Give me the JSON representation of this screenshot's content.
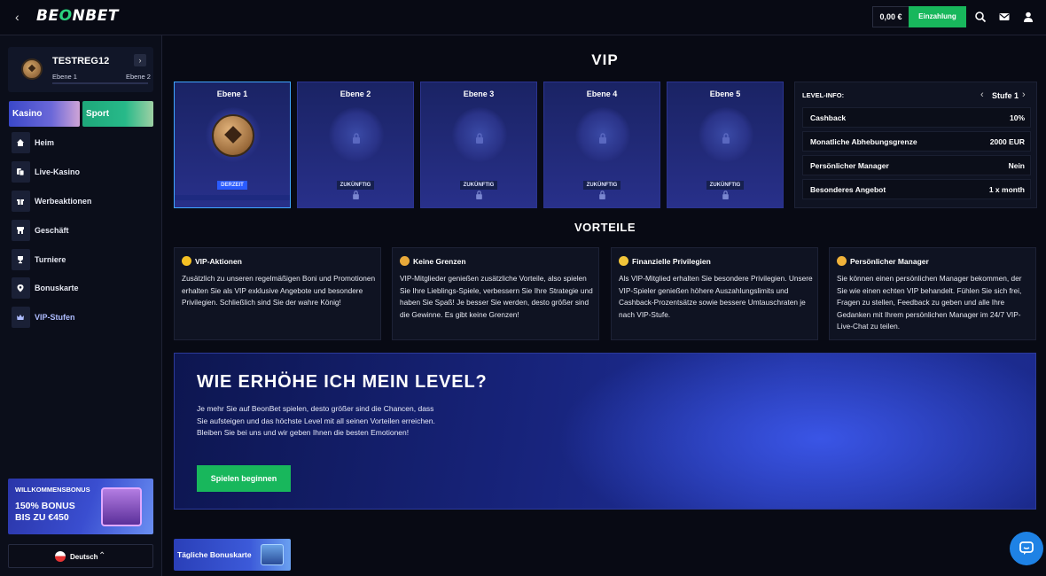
{
  "header": {
    "logo": "BEONBET",
    "balance": "0,00 €",
    "deposit_label": "Einzahlung"
  },
  "profile": {
    "username": "TESTREG12",
    "current_level": "Ebene 1",
    "next_level": "Ebene 2"
  },
  "categories": {
    "casino": "Kasino",
    "sport": "Sport"
  },
  "nav": {
    "items": [
      "Heim",
      "Live-Kasino",
      "Werbeaktionen",
      "Geschäft",
      "Turniere",
      "Bonuskarte",
      "VIP-Stufen"
    ]
  },
  "promo": {
    "small": "WILLKOMMENSBONUS",
    "big": "150% BONUS BIS ZU €450"
  },
  "language": {
    "label": "Deutsch"
  },
  "vip": {
    "title": "VIP",
    "tiers": [
      {
        "name": "Ebene 1",
        "status": "DERZEIT"
      },
      {
        "name": "Ebene 2",
        "status": "ZUKÜNFTIG"
      },
      {
        "name": "Ebene 3",
        "status": "ZUKÜNFTIG"
      },
      {
        "name": "Ebene 4",
        "status": "ZUKÜNFTIG"
      },
      {
        "name": "Ebene 5",
        "status": "ZUKÜNFTIG"
      }
    ]
  },
  "level_info": {
    "heading": "LEVEL-INFO:",
    "stage": "Stufe 1",
    "rows": [
      {
        "key": "Cashback",
        "value": "10%"
      },
      {
        "key": "Monatliche Abhebungsgrenze",
        "value": "2000 EUR"
      },
      {
        "key": "Persönlicher Manager",
        "value": "Nein"
      },
      {
        "key": "Besonderes Angebot",
        "value": "1 x month"
      }
    ]
  },
  "benefits": {
    "title": "VORTEILE",
    "cards": [
      {
        "title": "VIP-Aktionen",
        "text": "Zusätzlich zu unseren regelmäßigen Boni und Promotionen erhalten Sie als VIP exklusive Angebote und besondere Privilegien. Schließlich sind Sie der wahre König!",
        "icon": "lightning-icon"
      },
      {
        "title": "Keine Grenzen",
        "text": "VIP-Mitglieder genießen zusätzliche Vorteile, also spielen Sie Ihre Lieblings-Spiele, verbessern Sie Ihre Strategie und haben Sie Spaß! Je besser Sie werden, desto größer sind die Gewinne. Es gibt keine Grenzen!",
        "icon": "coin-icon"
      },
      {
        "title": "Finanzielle Privilegien",
        "text": "Als VIP-Mitglied erhalten Sie besondere Privilegien. Unsere VIP-Spieler genießen höhere Auszahlungslimits und Cashback-Prozentsätze sowie bessere Umtauschraten je nach VIP-Stufe.",
        "icon": "money-icon"
      },
      {
        "title": "Persönlicher Manager",
        "text": "Sie können einen persönlichen Manager bekommen, der Sie wie einen echten VIP behandelt. Fühlen Sie sich frei, Fragen zu stellen, Feedback zu geben und alle Ihre Gedanken mit Ihrem persönlichen Manager im 24/7 VIP-Live-Chat zu teilen.",
        "icon": "manager-icon"
      }
    ]
  },
  "hero": {
    "title": "WIE ERHÖHE ICH MEIN LEVEL?",
    "text": "Je mehr Sie auf BeonBet spielen, desto größer sind die Chancen, dass Sie aufsteigen und das höchste Level mit all seinen Vorteilen erreichen. Bleiben Sie bei uns und wir geben Ihnen die besten Emotionen!",
    "button": "Spielen beginnen"
  },
  "daily": {
    "label": "Tägliche Bonuskarte"
  },
  "colors": {
    "accent_green": "#18b75c",
    "tier_blue": "#28308a",
    "background": "#080a14"
  }
}
